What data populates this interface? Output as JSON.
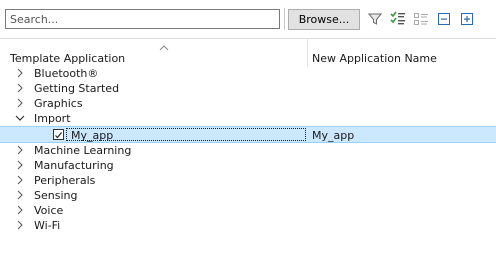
{
  "toolbar": {
    "search_placeholder": "Search...",
    "browse_label": "Browse...",
    "icons": [
      "filter-icon",
      "checklist-icon",
      "list-details-icon",
      "collapse-all-icon",
      "expand-all-icon"
    ]
  },
  "columns": {
    "template": "Template Application",
    "new_name": "New Application Name"
  },
  "tree": {
    "items": [
      {
        "label": "Bluetooth®",
        "state": "collapsed"
      },
      {
        "label": "Getting Started",
        "state": "collapsed"
      },
      {
        "label": "Graphics",
        "state": "collapsed"
      },
      {
        "label": "Import",
        "state": "expanded"
      },
      {
        "label": "Machine Learning",
        "state": "collapsed"
      },
      {
        "label": "Manufacturing",
        "state": "collapsed"
      },
      {
        "label": "Peripherals",
        "state": "collapsed"
      },
      {
        "label": "Sensing",
        "state": "collapsed"
      },
      {
        "label": "Voice",
        "state": "collapsed"
      },
      {
        "label": "Wi-Fi",
        "state": "collapsed"
      }
    ],
    "import_child": {
      "label": "My_app",
      "new_name": "My_app",
      "checked": true
    }
  },
  "colors": {
    "selection": "#cce8ff",
    "accent_green": "#3a9a3a",
    "icon_blue": "#2b6cb0"
  }
}
